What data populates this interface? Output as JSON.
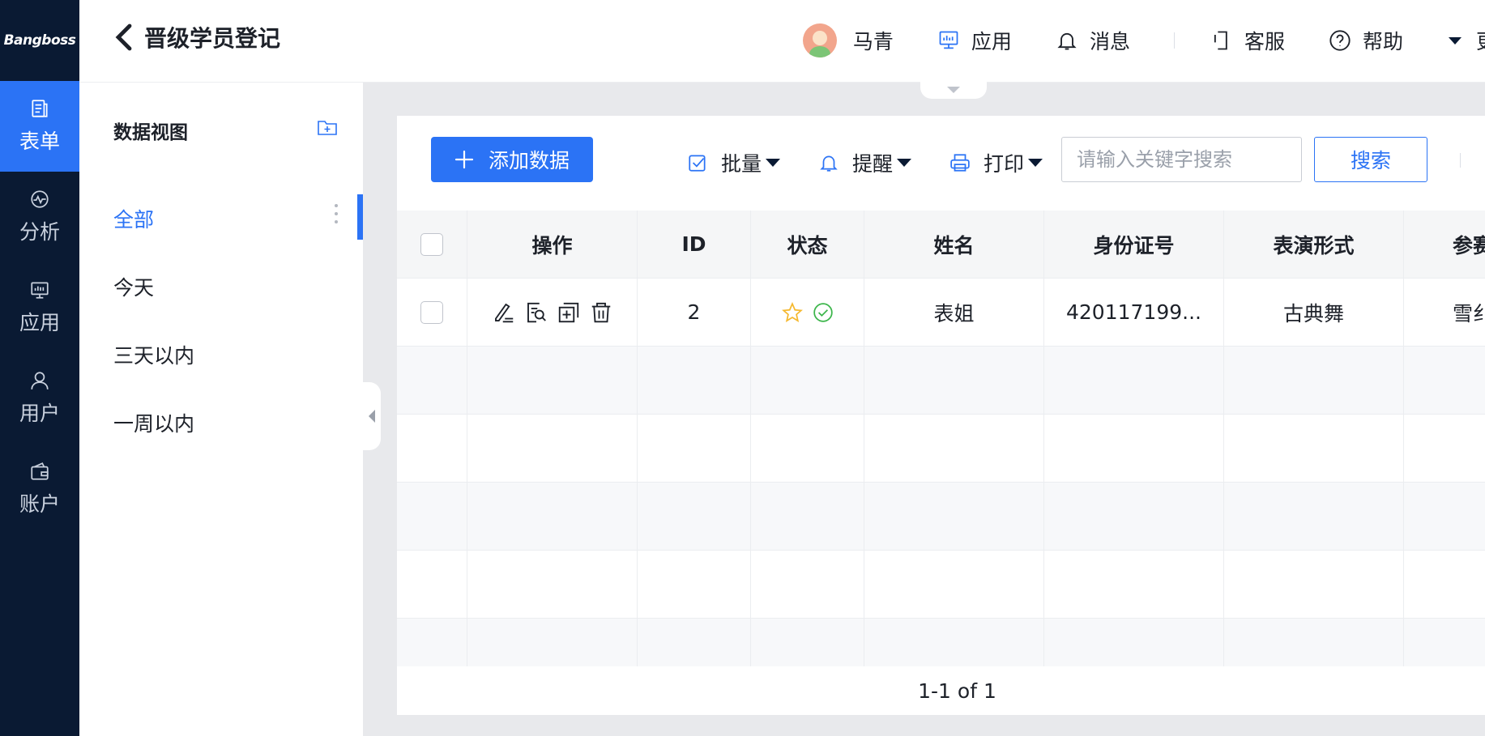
{
  "brand": {
    "logo_text": "Bangboss"
  },
  "rail": {
    "items": [
      {
        "label": "表单",
        "icon": "form-icon",
        "active": true
      },
      {
        "label": "分析",
        "icon": "analysis-icon",
        "active": false
      },
      {
        "label": "应用",
        "icon": "monitor-icon",
        "active": false
      },
      {
        "label": "用户",
        "icon": "user-icon",
        "active": false
      },
      {
        "label": "账户",
        "icon": "wallet-icon",
        "active": false
      }
    ]
  },
  "header": {
    "title": "晋级学员登记",
    "user_name": "马青",
    "apps_label": "应用",
    "messages_label": "消息",
    "service_label": "客服",
    "help_label": "帮助",
    "more_label": "更"
  },
  "views": {
    "heading": "数据视图",
    "items": [
      "全部",
      "今天",
      "三天以内",
      "一周以内"
    ],
    "active_index": 0
  },
  "toolbar": {
    "add_label": "添加数据",
    "batch_label": "批量",
    "remind_label": "提醒",
    "print_label": "打印",
    "search_placeholder": "请输入关键字搜索",
    "search_value": "",
    "search_button": "搜索"
  },
  "table": {
    "columns": [
      "操作",
      "ID",
      "状态",
      "姓名",
      "身份证号",
      "表演形式",
      "参赛"
    ],
    "rows": [
      {
        "id": "2",
        "name": "表姐",
        "id_card": "420117199...",
        "performance": "古典舞",
        "entry": "雪纟"
      }
    ]
  },
  "pagination": {
    "range": "1-1 of 1"
  },
  "colors": {
    "accent": "#2b73f5",
    "rail_bg": "#0a1a33"
  }
}
